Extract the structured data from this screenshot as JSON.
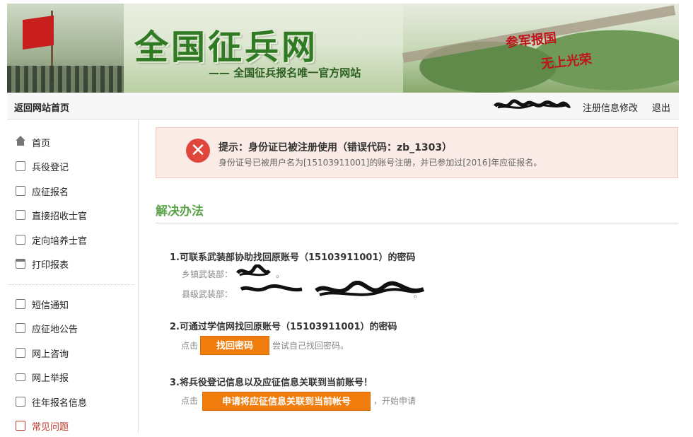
{
  "banner": {
    "site_title": "全国征兵网",
    "subtitle": "—— 全国征兵报名唯一官方网站",
    "slogan_line1": "参军报国",
    "slogan_line2": "无上光荣"
  },
  "topbar": {
    "home_link": "返回网站首页",
    "edit_link": "注册信息修改",
    "logout_link": "退出"
  },
  "sidebar": {
    "items": [
      {
        "label": "首页",
        "icon": "home-icon"
      },
      {
        "label": "兵役登记",
        "icon": "clipboard-icon"
      },
      {
        "label": "应征报名",
        "icon": "document-icon"
      },
      {
        "label": "直接招收士官",
        "icon": "badge-icon"
      },
      {
        "label": "定向培养士官",
        "icon": "badge-icon"
      },
      {
        "label": "打印报表",
        "icon": "printer-icon"
      },
      {
        "label": "短信通知",
        "icon": "chat-icon"
      },
      {
        "label": "应征地公告",
        "icon": "chat-icon"
      },
      {
        "label": "网上咨询",
        "icon": "chat-icon"
      },
      {
        "label": "网上举报",
        "icon": "mail-icon"
      },
      {
        "label": "往年报名信息",
        "icon": "badge-icon"
      },
      {
        "label": "常见问题",
        "icon": "document-icon"
      }
    ],
    "active_item": "常见问题"
  },
  "alert": {
    "title": "提示：身份证已被注册使用（错误代码：zb_1303）",
    "detail": "身份证号已被用户名为[15103911001]的账号注册，并已参加过[2016]年应征报名。",
    "icon": "error-x-icon",
    "color": "#e0463c"
  },
  "solution": {
    "heading": "解决办法",
    "step1": {
      "title": "1.可联系武装部协助找回原账号（15103911001）的密码",
      "town_label": "乡镇武装部：",
      "town_suffix": "。",
      "county_label": "县级武装部：",
      "county_suffix": "。"
    },
    "step2": {
      "title": "2.可通过学信网找回原账号（15103911001）的密码",
      "prefix": "点击",
      "button": "找回密码",
      "suffix": "尝试自己找回密码。"
    },
    "step3": {
      "title": "3.将兵役登记信息以及应征信息关联到当前账号！",
      "prefix": "点击",
      "button": "申请将应征信息关联到当前帐号",
      "suffix": "，开始申请"
    }
  },
  "colors": {
    "accent_green": "#5aa34a",
    "button_orange": "#f07d0e",
    "alert_bg": "#fbebe6"
  }
}
